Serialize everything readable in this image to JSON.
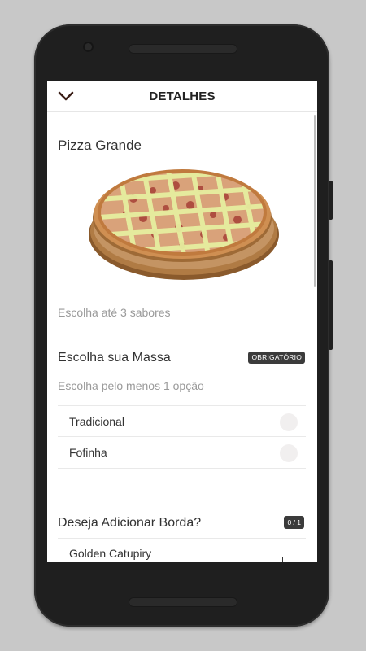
{
  "header": {
    "title": "DETALHES",
    "back_icon": "chevron-down-icon"
  },
  "product": {
    "name": "Pizza Grande",
    "image": "pizza-image",
    "flavors_hint": "Escolha até 3 sabores"
  },
  "massa_section": {
    "title": "Escolha sua Massa",
    "badge": "OBRIGATÓRIO",
    "subtitle": "Escolha pelo menos 1 opção",
    "options": [
      {
        "label": "Tradicional",
        "selected": false
      },
      {
        "label": "Fofinha",
        "selected": false
      }
    ]
  },
  "borda_section": {
    "title": "Deseja Adicionar Borda?",
    "counter": "0 / 1",
    "options": [
      {
        "label": "Golden Catupiry"
      }
    ]
  },
  "colors": {
    "badge_bg": "#3b3b3b",
    "radio_bg": "#f1efef",
    "text": "#333333",
    "muted": "#9a9a9a"
  }
}
